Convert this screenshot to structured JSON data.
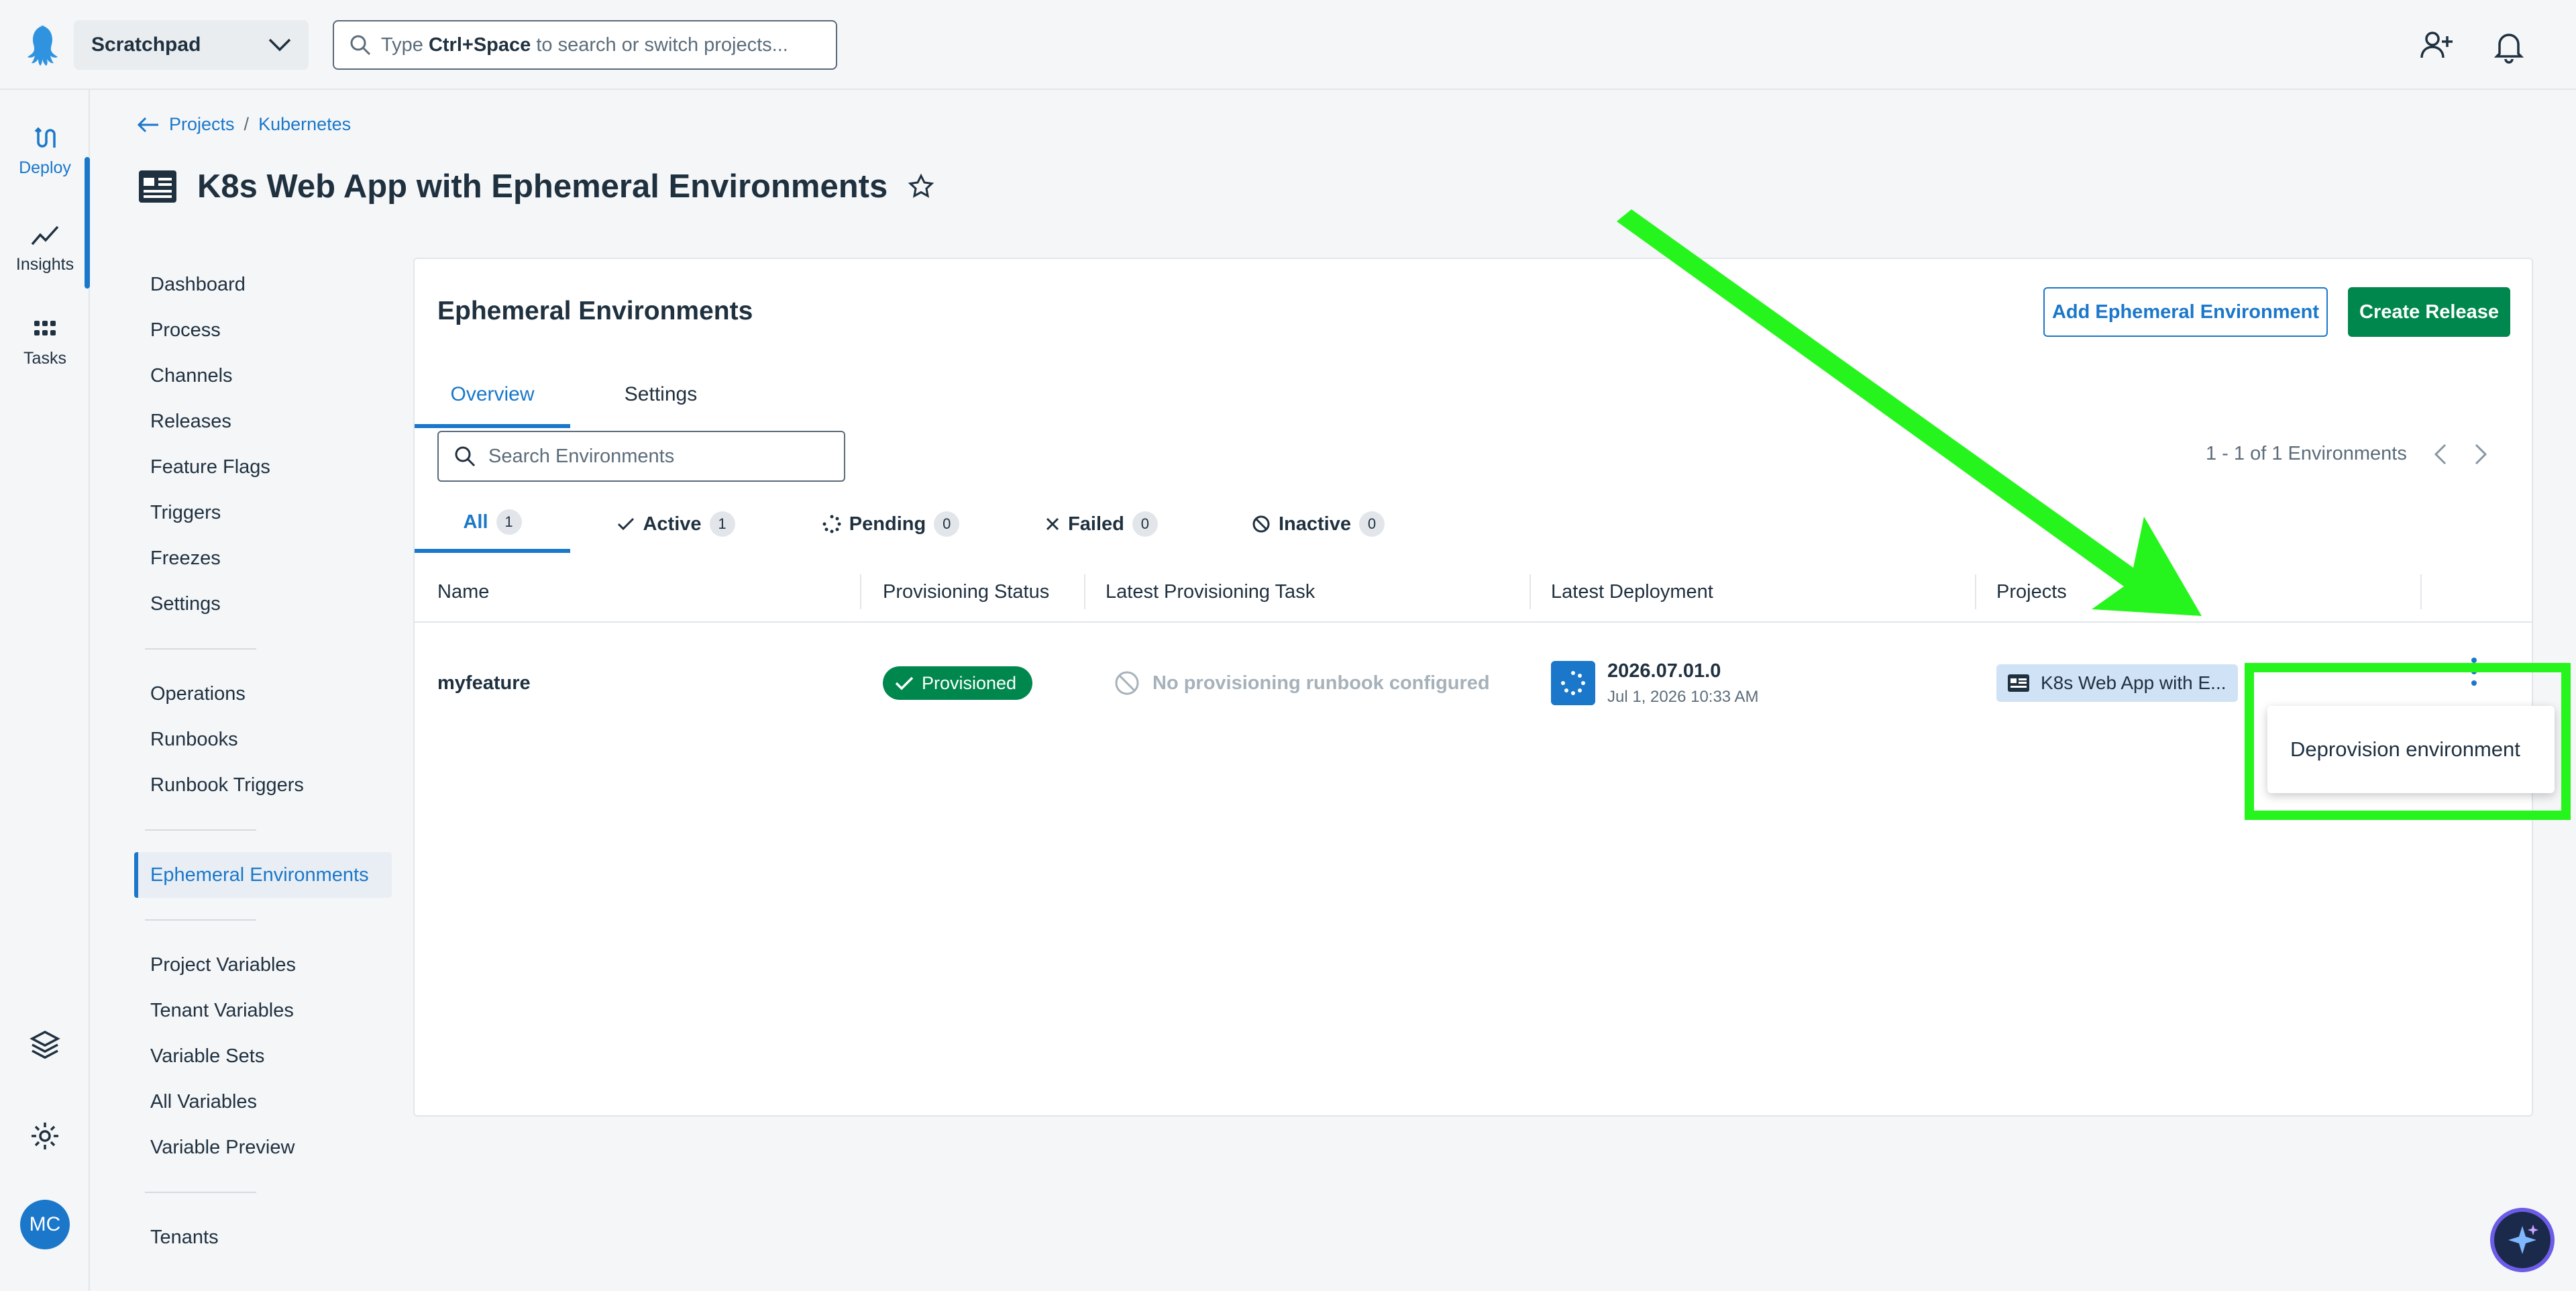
{
  "topbar": {
    "space_name": "Scratchpad",
    "search_prefix": "Type ",
    "search_key": "Ctrl+Space",
    "search_suffix": " to search or switch projects..."
  },
  "rail": {
    "items": [
      {
        "label": "Deploy"
      },
      {
        "label": "Insights"
      },
      {
        "label": "Tasks"
      }
    ],
    "avatar_initials": "MC"
  },
  "breadcrumb": {
    "projects": "Projects",
    "separator": "/",
    "group": "Kubernetes"
  },
  "page": {
    "title": "K8s Web App with Ephemeral Environments"
  },
  "leftnav": {
    "group1": [
      "Dashboard",
      "Process",
      "Channels",
      "Releases",
      "Feature Flags",
      "Triggers",
      "Freezes",
      "Settings"
    ],
    "group2": [
      "Operations",
      "Runbooks",
      "Runbook Triggers"
    ],
    "group3": [
      "Ephemeral Environments"
    ],
    "group4": [
      "Project Variables",
      "Tenant Variables",
      "Variable Sets",
      "All Variables",
      "Variable Preview"
    ],
    "group5": [
      "Tenants"
    ]
  },
  "card": {
    "title": "Ephemeral Environments",
    "add_button": "Add Ephemeral Environment",
    "create_button": "Create Release",
    "tabs": [
      "Overview",
      "Settings"
    ],
    "search_placeholder": "Search Environments",
    "pager_text": "1 - 1 of 1 Environments",
    "filters": [
      {
        "label": "All",
        "count": "1"
      },
      {
        "label": "Active",
        "count": "1"
      },
      {
        "label": "Pending",
        "count": "0"
      },
      {
        "label": "Failed",
        "count": "0"
      },
      {
        "label": "Inactive",
        "count": "0"
      }
    ],
    "columns": [
      "Name",
      "Provisioning Status",
      "Latest Provisioning Task",
      "Latest Deployment",
      "Projects"
    ],
    "row": {
      "name": "myfeature",
      "status": "Provisioned",
      "task": "No provisioning runbook configured",
      "release": "2026.07.01.0",
      "release_date": "Jul 1, 2026 10:33 AM",
      "project": "K8s Web App with E..."
    }
  },
  "menu": {
    "item": "Deprovision environment"
  },
  "colors": {
    "accent": "#1a77ca",
    "success": "#00874d",
    "annotation": "#26f51d"
  }
}
